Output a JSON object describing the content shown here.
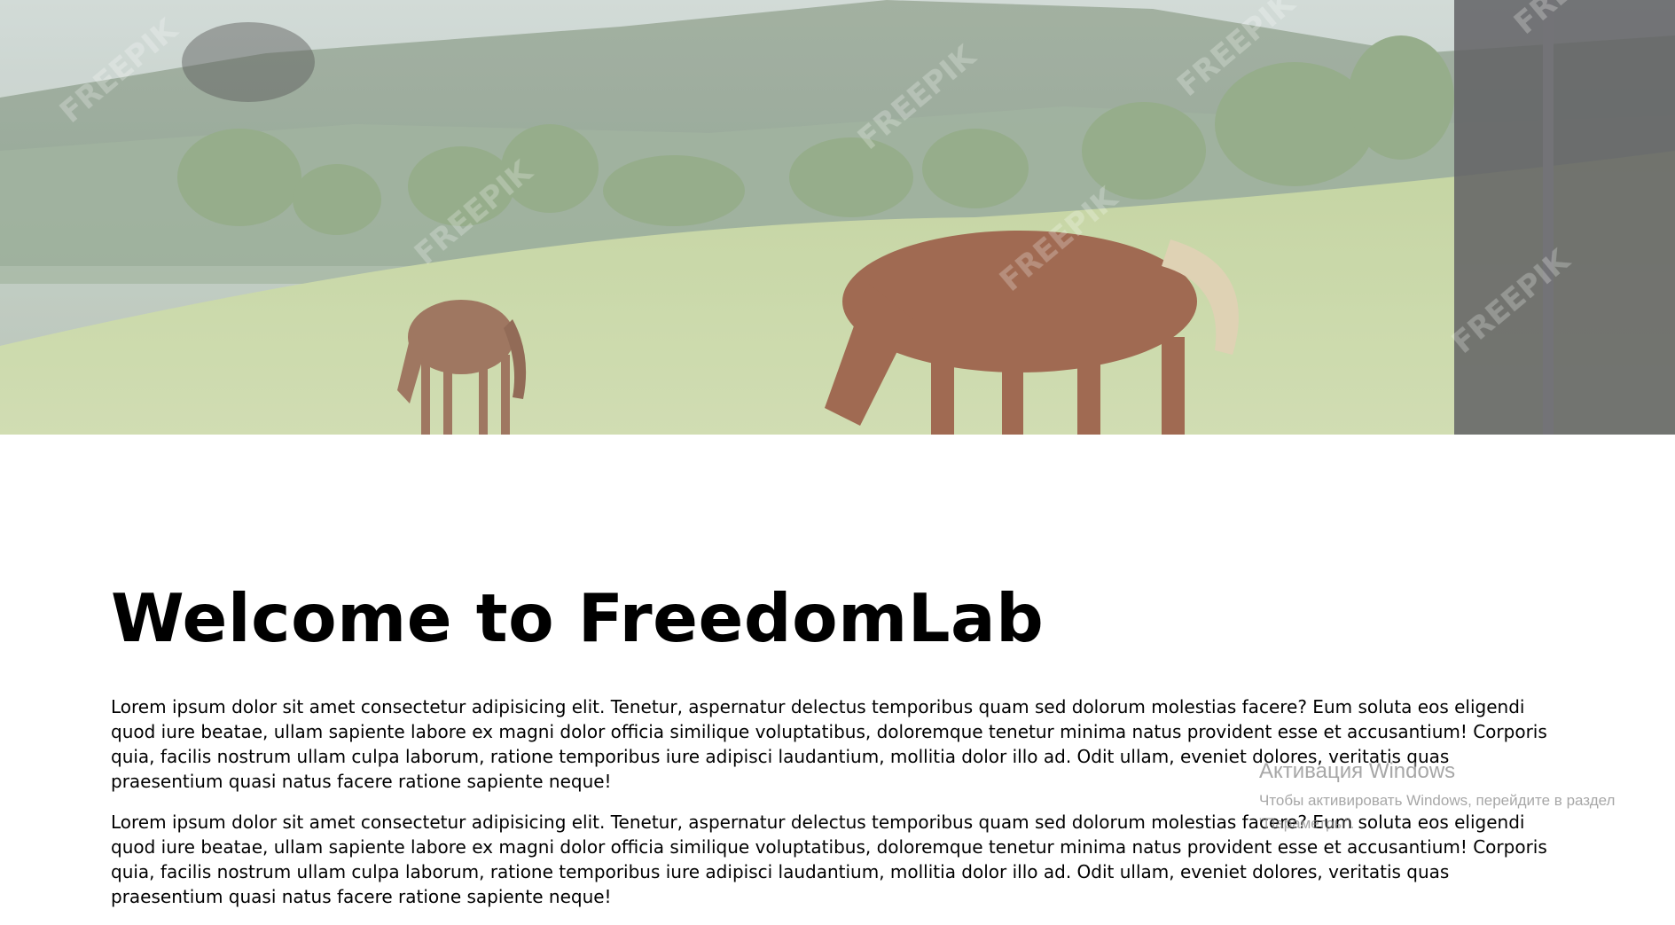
{
  "hero": {
    "image_description": "horses grazing on a green hillside",
    "watermark": "FREEPIK"
  },
  "main": {
    "title": "Welcome to FreedomLab",
    "paragraphs": [
      "Lorem ipsum dolor sit amet consectetur adipisicing elit. Tenetur, aspernatur delectus temporibus quam sed dolorum molestias facere? Eum soluta eos eligendi quod iure beatae, ullam sapiente labore ex magni dolor officia similique voluptatibus, doloremque tenetur minima natus provident esse et accusantium! Corporis quia, facilis nostrum ullam culpa laborum, ratione temporibus iure adipisci laudantium, mollitia dolor illo ad. Odit ullam, eveniet dolores, veritatis quas praesentium quasi natus facere ratione sapiente neque!",
      "Lorem ipsum dolor sit amet consectetur adipisicing elit. Tenetur, aspernatur delectus temporibus quam sed dolorum molestias facere? Eum soluta eos eligendi quod iure beatae, ullam sapiente labore ex magni dolor officia similique voluptatibus, doloremque tenetur minima natus provident esse et accusantium! Corporis quia, facilis nostrum ullam culpa laborum, ratione temporibus iure adipisci laudantium, mollitia dolor illo ad. Odit ullam, eveniet dolores, veritatis quas praesentium quasi natus facere ratione sapiente neque!"
    ]
  },
  "os_overlay": {
    "title": "Активация Windows",
    "text": "Чтобы активировать Windows, перейдите в раздел \"Параметры\"."
  }
}
